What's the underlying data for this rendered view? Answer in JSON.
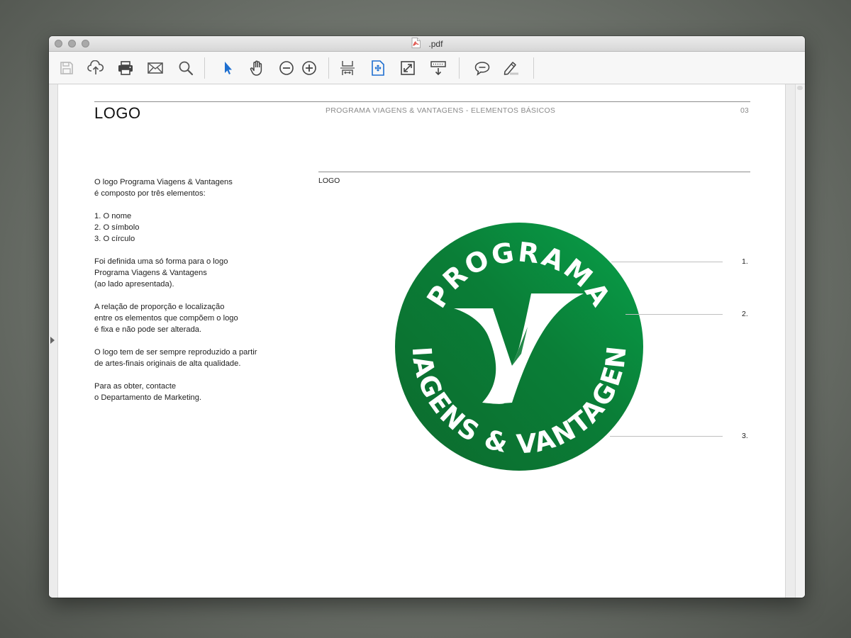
{
  "window": {
    "title": ".pdf"
  },
  "toolbar": {
    "buttons": [
      {
        "name": "save-icon"
      },
      {
        "name": "upload-icon"
      },
      {
        "name": "print-icon"
      },
      {
        "name": "mail-icon"
      },
      {
        "name": "search-icon"
      },
      {
        "name": "select-arrow-icon"
      },
      {
        "name": "hand-icon"
      },
      {
        "name": "zoom-out-icon"
      },
      {
        "name": "zoom-in-icon"
      },
      {
        "name": "fit-width-icon"
      },
      {
        "name": "fit-page-icon"
      },
      {
        "name": "fullscreen-icon"
      },
      {
        "name": "scroll-mode-icon"
      },
      {
        "name": "comment-icon"
      },
      {
        "name": "highlight-icon"
      }
    ],
    "accent_color": "#1e6fd0"
  },
  "page": {
    "title": "LOGO",
    "header": "PROGRAMA VIAGENS & VANTAGENS - ELEMENTOS BÁSICOS",
    "page_number": "03",
    "section_label": "LOGO",
    "paragraphs": [
      [
        "O logo Programa Viagens & Vantagens",
        "é composto por três elementos:"
      ],
      [
        "1. O nome",
        "2. O símbolo",
        "3. O círculo"
      ],
      [
        "Foi definida uma só forma para o logo",
        "Programa Viagens & Vantagens",
        "(ao lado apresentada)."
      ],
      [
        "A relação de proporção e localização",
        "entre os elementos que compõem o logo",
        "é fixa e não pode ser alterada."
      ],
      [
        "O logo tem de ser sempre reproduzido a partir",
        "de artes-finais originais de alta qualidade."
      ],
      [
        "Para as obter, contacte",
        "o Departamento de Marketing."
      ]
    ],
    "logo": {
      "top_text": "PROGRAMA",
      "bottom_text": "VIAGENS & VANTAGENS",
      "colors": {
        "dark_green": "#0e6b2e",
        "light_green": "#079b45",
        "white": "#ffffff"
      }
    },
    "callouts": [
      "1.",
      "2.",
      "3."
    ]
  }
}
